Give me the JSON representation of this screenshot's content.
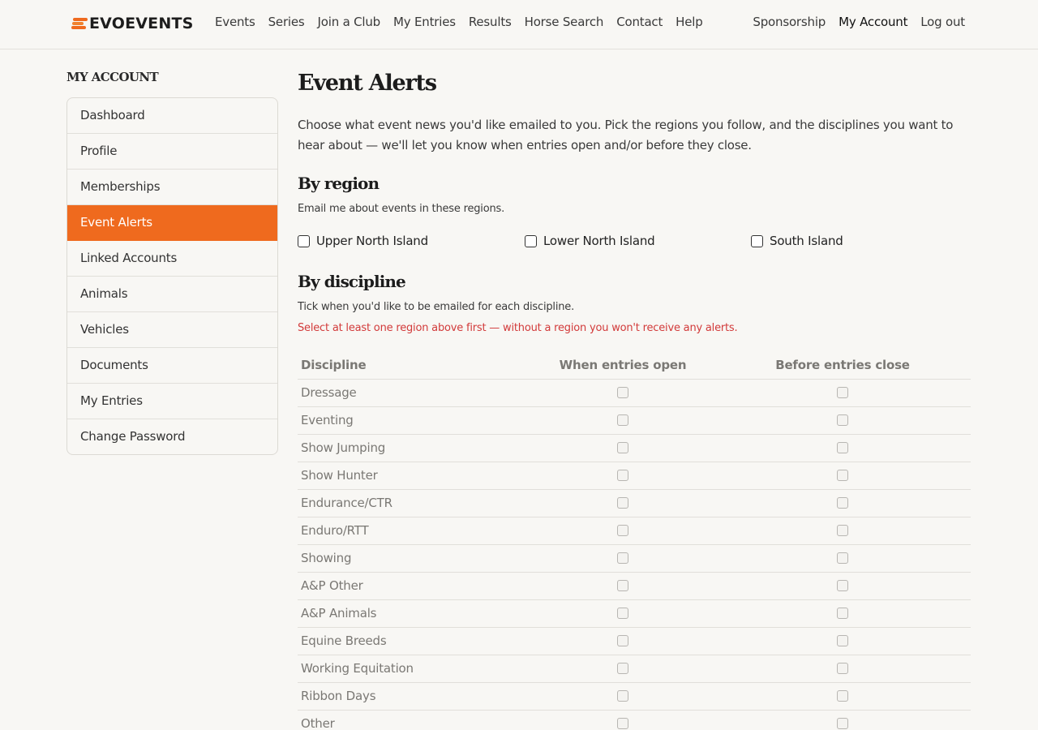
{
  "brand": {
    "logo_text": "EVOEVENTS",
    "accent_color": "#ef6a1e"
  },
  "nav": {
    "main": [
      "Events",
      "Series",
      "Join a Club",
      "My Entries",
      "Results",
      "Horse Search",
      "Contact",
      "Help"
    ],
    "right": [
      "Sponsorship",
      "My Account",
      "Log out"
    ],
    "active_right": "My Account"
  },
  "sidebar": {
    "heading": "MY ACCOUNT",
    "items": [
      {
        "label": "Dashboard"
      },
      {
        "label": "Profile"
      },
      {
        "label": "Memberships"
      },
      {
        "label": "Event Alerts",
        "active": true
      },
      {
        "label": "Linked Accounts"
      },
      {
        "label": "Animals"
      },
      {
        "label": "Vehicles"
      },
      {
        "label": "Documents"
      },
      {
        "label": "My Entries"
      },
      {
        "label": "Change Password"
      }
    ]
  },
  "main": {
    "title": "Event Alerts",
    "intro": "Choose what event news you'd like emailed to you. Pick the regions you follow, and the disciplines you want to hear about — we'll let you know when entries open and/or before they close.",
    "region_section": {
      "title": "By region",
      "subtitle": "Email me about events in these regions.",
      "regions": [
        {
          "label": "Upper North Island",
          "checked": false
        },
        {
          "label": "Lower North Island",
          "checked": false
        },
        {
          "label": "South Island",
          "checked": false
        }
      ]
    },
    "discipline_section": {
      "title": "By discipline",
      "subtitle": "Tick when you'd like to be emailed for each discipline.",
      "warning": "Select at least one region above first — without a region you won't receive any alerts.",
      "columns": [
        "Discipline",
        "When entries open",
        "Before entries close"
      ],
      "rows": [
        "Dressage",
        "Eventing",
        "Show Jumping",
        "Show Hunter",
        "Endurance/CTR",
        "Enduro/RTT",
        "Showing",
        "A&P Other",
        "A&P Animals",
        "Equine Breeds",
        "Working Equitation",
        "Ribbon Days",
        "Other"
      ]
    }
  }
}
